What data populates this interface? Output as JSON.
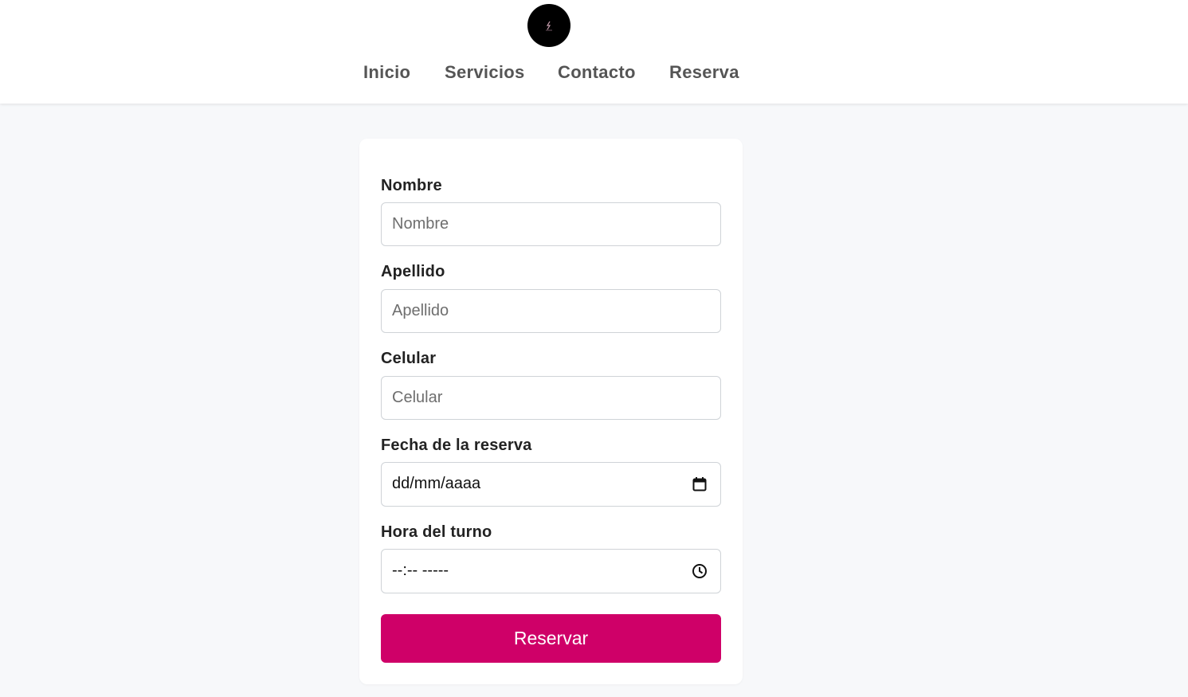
{
  "header": {
    "logo_icon": "brand-logo-icon",
    "nav": [
      {
        "label": "Inicio"
      },
      {
        "label": "Servicios"
      },
      {
        "label": "Contacto"
      },
      {
        "label": "Reserva"
      }
    ]
  },
  "form": {
    "nombre": {
      "label": "Nombre",
      "placeholder": "Nombre",
      "value": ""
    },
    "apellido": {
      "label": "Apellido",
      "placeholder": "Apellido",
      "value": ""
    },
    "celular": {
      "label": "Celular",
      "placeholder": "Celular",
      "value": ""
    },
    "fecha": {
      "label": "Fecha de la reserva",
      "value": "dd/mm/aaaa",
      "icon": "calendar-icon"
    },
    "hora": {
      "label": "Hora del turno",
      "value": "--:-- -----",
      "icon": "clock-icon"
    },
    "submit_label": "Reservar"
  },
  "colors": {
    "accent": "#cf0068",
    "page_bg": "#f7f8fa",
    "nav_text": "#555555"
  }
}
